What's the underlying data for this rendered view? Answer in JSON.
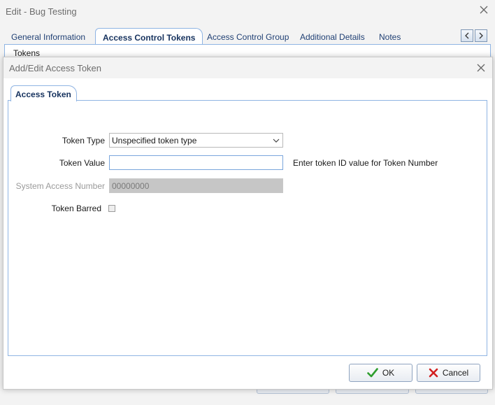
{
  "window": {
    "title": "Edit - Bug Testing"
  },
  "outer_tabs": [
    {
      "label": "General Information"
    },
    {
      "label": "Access Control Tokens"
    },
    {
      "label": "Access Control Group"
    },
    {
      "label": "Additional Details"
    },
    {
      "label": "Notes"
    }
  ],
  "outer_panel": {
    "section_label": "Tokens"
  },
  "dialog": {
    "title": "Add/Edit Access Token",
    "tab": "Access Token",
    "fields": {
      "token_type": {
        "label": "Token Type",
        "value": "Unspecified token type"
      },
      "token_value": {
        "label": "Token Value",
        "value": "",
        "hint": "Enter token ID value for Token Number"
      },
      "system_access_number": {
        "label": "System Access Number",
        "value": "00000000"
      },
      "token_barred": {
        "label": "Token Barred",
        "checked": false
      }
    },
    "buttons": {
      "ok": "OK",
      "cancel": "Cancel"
    }
  },
  "colors": {
    "accent_border": "#8fb4e3",
    "ok_green": "#2e9e2e",
    "cancel_red": "#d21f1f",
    "tab_text": "#16325e"
  }
}
